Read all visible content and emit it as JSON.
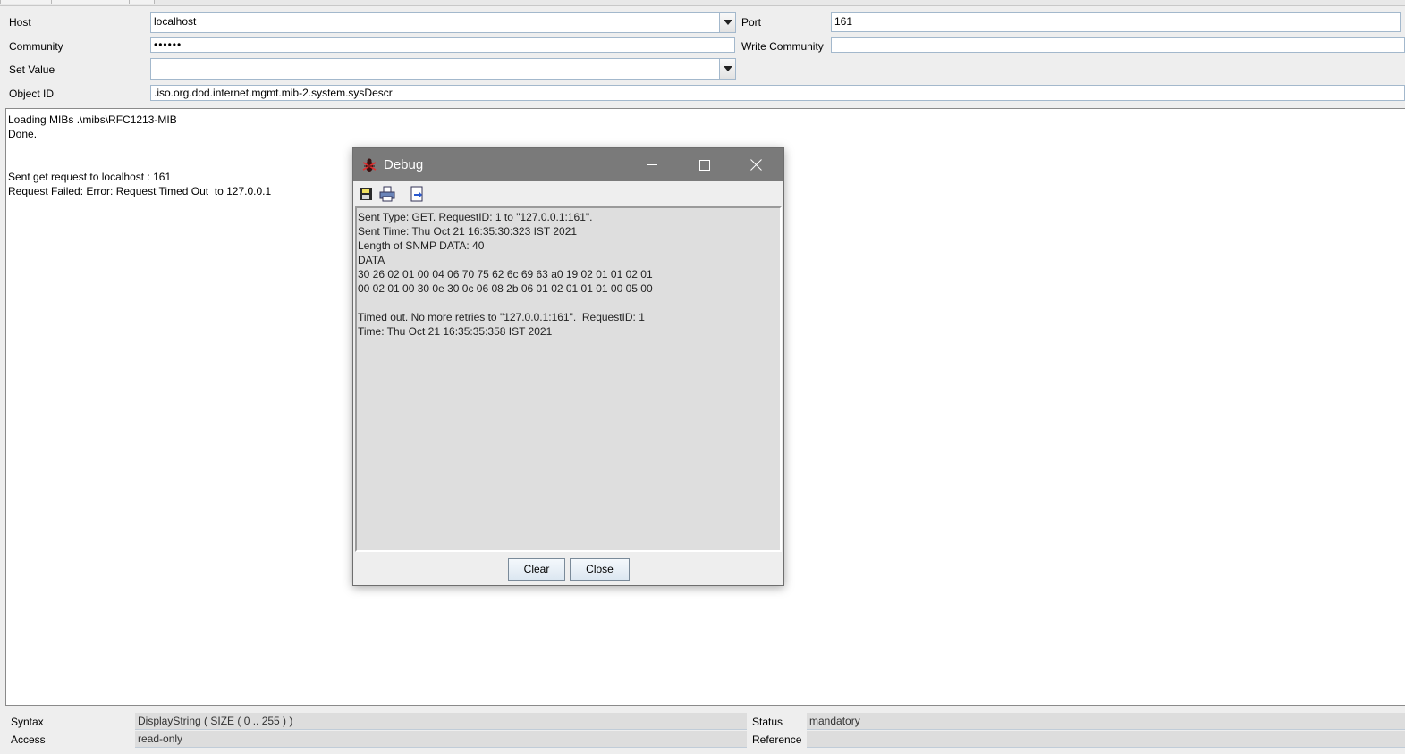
{
  "form": {
    "host_label": "Host",
    "host_value": "localhost",
    "port_label": "Port",
    "port_value": "161",
    "community_label": "Community",
    "community_value": "••••••",
    "write_community_label": "Write Community",
    "write_community_value": "",
    "set_value_label": "Set Value",
    "set_value_value": "",
    "object_id_label": "Object ID",
    "object_id_value": ".iso.org.dod.internet.mgmt.mib-2.system.sysDescr"
  },
  "output": {
    "lines": [
      "Loading MIBs .\\mibs\\RFC1213-MIB",
      "Done.",
      "",
      "",
      "Sent get request to localhost : 161",
      "Request Failed: Error: Request Timed Out  to 127.0.0.1"
    ]
  },
  "details": {
    "syntax_label": "Syntax",
    "syntax_value": "DisplayString  ( SIZE ( 0 .. 255  ) )",
    "access_label": "Access",
    "access_value": "read-only",
    "status_label": "Status",
    "status_value": "mandatory",
    "reference_label": "Reference",
    "reference_value": ""
  },
  "debug_dialog": {
    "title": "Debug",
    "toolbar_icons": [
      "save-icon",
      "print-icon",
      "export-icon"
    ],
    "lines": [
      "Sent Type: GET. RequestID: 1 to \"127.0.0.1:161\".",
      "Sent Time: Thu Oct 21 16:35:30:323 IST 2021",
      "Length of SNMP DATA: 40",
      "DATA",
      "30 26 02 01 00 04 06 70 75 62 6c 69 63 a0 19 02 01 01 02 01",
      "00 02 01 00 30 0e 30 0c 06 08 2b 06 01 02 01 01 01 00 05 00",
      "",
      "Timed out. No more retries to \"127.0.0.1:161\".  RequestID: 1",
      "Time: Thu Oct 21 16:35:35:358 IST 2021"
    ],
    "clear_label": "Clear",
    "close_label": "Close"
  },
  "colors": {
    "titlebar": "#7a7a7a",
    "field_border": "#a3b8cc",
    "button_border": "#7a8a99"
  }
}
